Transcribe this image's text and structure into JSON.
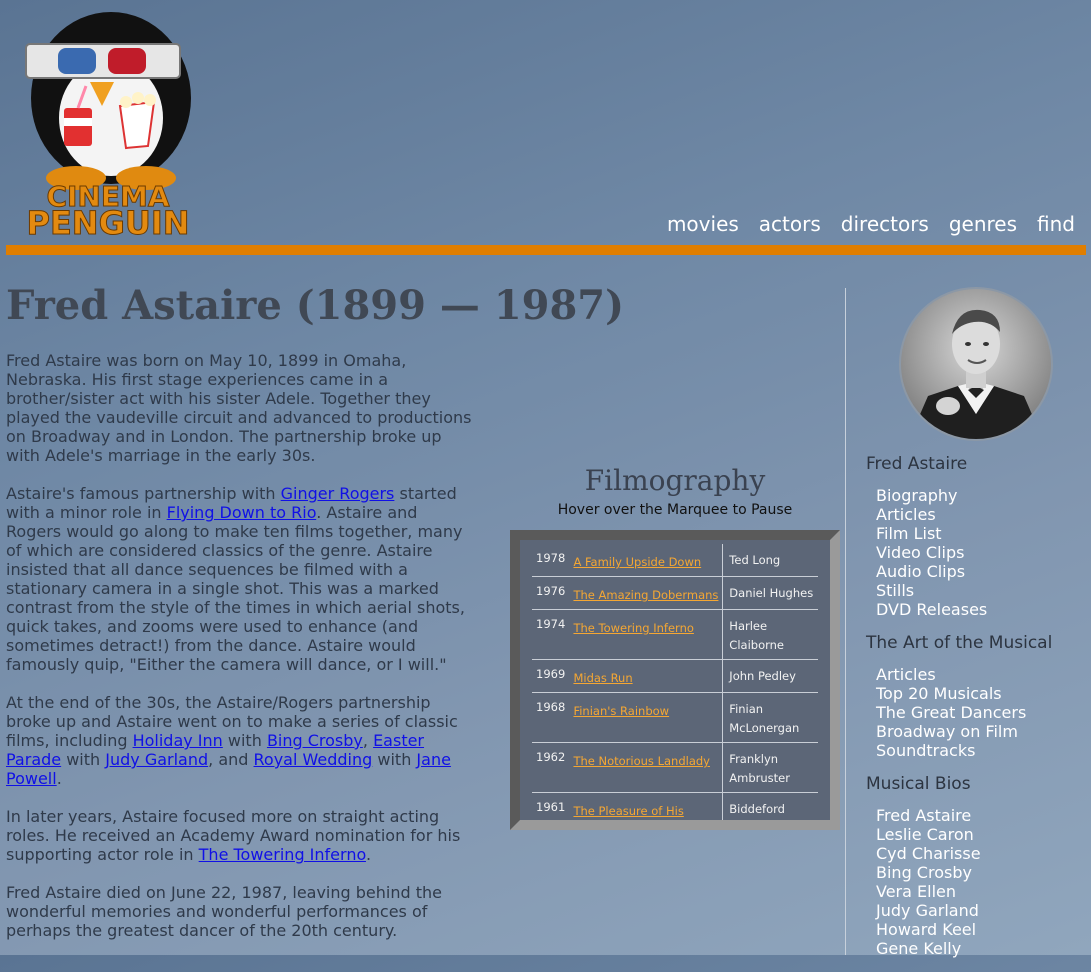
{
  "header": {
    "logo_alt": "Cinema Penguin",
    "logo_text_line1": "CINEMA",
    "logo_text_line2": "PENGUIN",
    "nav": [
      {
        "label": "movies"
      },
      {
        "label": "actors"
      },
      {
        "label": "directors"
      },
      {
        "label": "genres"
      },
      {
        "label": "find"
      }
    ]
  },
  "page": {
    "title": "Fred Astaire (1899 — 1987)"
  },
  "bio": {
    "p1": "Fred Astaire was born on May 10, 1899 in Omaha, Nebraska. His first stage experiences came in a brother/sister act with his sister Adele. Together they played the vaudeville circuit and advanced to productions on Broadway and in London. The partnership broke up with Adele's marriage in the early 30s.",
    "p2": {
      "t1": "Astaire's famous partnership with ",
      "link1": "Ginger Rogers",
      "t2": " started with a minor role in ",
      "link2": "Flying Down to Rio",
      "t3": ". Astaire and Rogers would go along to make ten films together, many of which are considered classics of the genre. Astaire insisted that all dance sequences be filmed with a stationary camera in a single shot. This was a marked contrast from the style of the times in which aerial shots, quick takes, and zooms were used to enhance (and sometimes detract!) from the dance. Astaire would famously quip, \"Either the camera will dance, or I will.\""
    },
    "p3": {
      "t1": "At the end of the 30s, the Astaire/Rogers partnership broke up and Astaire went on to make a series of classic films, including ",
      "link1": "Holiday Inn",
      "t2": " with ",
      "link2": "Bing Crosby",
      "t3": ", ",
      "link3": "Easter Parade",
      "t4": " with ",
      "link4": "Judy Garland",
      "t5": ", and ",
      "link5": "Royal Wedding",
      "t6": " with ",
      "link6": "Jane Powell",
      "t7": "."
    },
    "p4": {
      "t1": "In later years, Astaire focused more on straight acting roles. He received an Academy Award nomination for his supporting actor role in ",
      "link1": "The Towering Inferno",
      "t2": "."
    },
    "p5": "Fred Astaire died on June 22, 1987, leaving behind the wonderful memories and wonderful performances of perhaps the greatest dancer of the 20th century."
  },
  "filmography": {
    "title": "Filmography",
    "subtitle": "Hover over the Marquee to Pause",
    "films": [
      {
        "year": "1978",
        "title": "A Family Upside Down",
        "role": "Ted Long"
      },
      {
        "year": "1976",
        "title": "The Amazing Dobermans",
        "role": "Daniel Hughes"
      },
      {
        "year": "1974",
        "title": "The Towering Inferno",
        "role": "Harlee Claiborne"
      },
      {
        "year": "1969",
        "title": "Midas Run",
        "role": "John Pedley"
      },
      {
        "year": "1968",
        "title": "Finian's Rainbow",
        "role": "Finian McLonergan"
      },
      {
        "year": "1962",
        "title": "The Notorious Landlady",
        "role": "Franklyn Ambruster"
      },
      {
        "year": "1961",
        "title": "The Pleasure of His Company",
        "role": "Biddeford"
      }
    ]
  },
  "sidebar": {
    "portrait_alt": "Fred Astaire portrait",
    "sections": [
      {
        "heading": "Fred Astaire",
        "items": [
          "Biography",
          "Articles",
          "Film List",
          "Video Clips",
          "Audio Clips",
          "Stills",
          "DVD Releases"
        ]
      },
      {
        "heading": "The Art of the Musical",
        "items": [
          "Articles",
          "Top 20 Musicals",
          "The Great Dancers",
          "Broadway on Film",
          "Soundtracks"
        ]
      },
      {
        "heading": "Musical Bios",
        "items": [
          "Fred Astaire",
          "Leslie Caron",
          "Cyd Charisse",
          "Bing Crosby",
          "Vera Ellen",
          "Judy Garland",
          "Howard Keel",
          "Gene Kelly"
        ]
      }
    ]
  },
  "colors": {
    "accent_orange": "#e07e00",
    "link_blue": "#1010e6",
    "film_link": "#f5a733"
  }
}
